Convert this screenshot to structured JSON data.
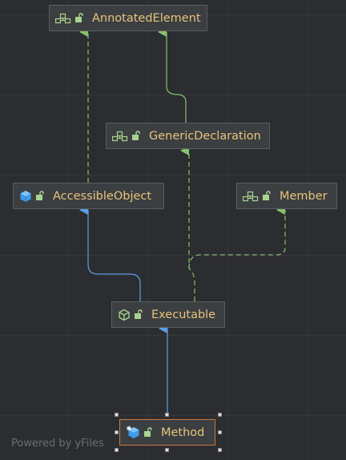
{
  "nodes": {
    "annotated_element": {
      "label": "AnnotatedElement",
      "kind": "interface"
    },
    "generic_declaration": {
      "label": "GenericDeclaration",
      "kind": "interface"
    },
    "accessible_object": {
      "label": "AccessibleObject",
      "kind": "class"
    },
    "member": {
      "label": "Member",
      "kind": "interface"
    },
    "executable": {
      "label": "Executable",
      "kind": "abstract-class"
    },
    "method": {
      "label": "Method",
      "kind": "class",
      "selected": true
    }
  },
  "edges": [
    {
      "from": "Method",
      "to": "Executable",
      "type": "extends",
      "style": "solid",
      "color": "#5aa0e6"
    },
    {
      "from": "Executable",
      "to": "AccessibleObject",
      "type": "extends",
      "style": "solid",
      "color": "#5aa0e6"
    },
    {
      "from": "Executable",
      "to": "GenericDeclaration",
      "type": "implements",
      "style": "dashed",
      "color": "#88c070"
    },
    {
      "from": "Executable",
      "to": "Member",
      "type": "implements",
      "style": "dashed",
      "color": "#88c070"
    },
    {
      "from": "AccessibleObject",
      "to": "AnnotatedElement",
      "type": "implements",
      "style": "dashed",
      "color": "#88c070"
    },
    {
      "from": "GenericDeclaration",
      "to": "AnnotatedElement",
      "type": "extends",
      "style": "solid",
      "color": "#88c070"
    }
  ],
  "colors": {
    "background": "#2b2d30",
    "node_fill": "#3c3f41",
    "node_text": "#e7c37c",
    "extends_arrow": "#5aa0e6",
    "implements_arrow": "#88c070",
    "selection": "#c9793c"
  },
  "watermark": "Powered by yFiles"
}
